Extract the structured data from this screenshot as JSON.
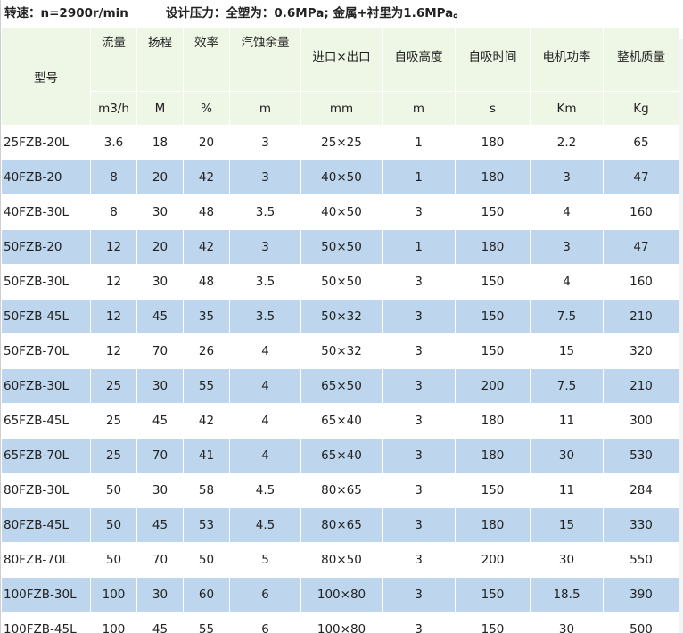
{
  "header": {
    "speed": "转速：n=2900r/min",
    "pressure": "设计压力：全塑为：0.6MPa; 金属+衬里为1.6MPa。"
  },
  "table": {
    "model_header": "型号",
    "columns": [
      {
        "name": "流量",
        "unit": "m3/h"
      },
      {
        "name": "扬程",
        "unit": "M"
      },
      {
        "name": "效率",
        "unit": "%"
      },
      {
        "name": "汽蚀余量",
        "unit": "m"
      },
      {
        "name": "进口×出口",
        "unit": "mm"
      },
      {
        "name": "自吸高度",
        "unit": "m"
      },
      {
        "name": "自吸时间",
        "unit": "s"
      },
      {
        "name": "电机功率",
        "unit": "Km"
      },
      {
        "name": "整机质量",
        "unit": "Kg"
      }
    ],
    "rows": [
      [
        "25FZB-20L",
        "3.6",
        "18",
        "20",
        "3",
        "25×25",
        "1",
        "180",
        "2.2",
        "65"
      ],
      [
        "40FZB-20",
        "8",
        "20",
        "42",
        "3",
        "40×50",
        "1",
        "180",
        "3",
        "47"
      ],
      [
        "40FZB-30L",
        "8",
        "30",
        "48",
        "3.5",
        "40×50",
        "3",
        "150",
        "4",
        "160"
      ],
      [
        "50FZB-20",
        "12",
        "20",
        "42",
        "3",
        "50×50",
        "1",
        "180",
        "3",
        "47"
      ],
      [
        "50FZB-30L",
        "12",
        "30",
        "48",
        "3.5",
        "50×50",
        "3",
        "150",
        "4",
        "160"
      ],
      [
        "50FZB-45L",
        "12",
        "45",
        "35",
        "3.5",
        "50×32",
        "3",
        "150",
        "7.5",
        "210"
      ],
      [
        "50FZB-70L",
        "12",
        "70",
        "26",
        "4",
        "50×32",
        "3",
        "150",
        "15",
        "320"
      ],
      [
        "60FZB-30L",
        "25",
        "30",
        "55",
        "4",
        "65×50",
        "3",
        "200",
        "7.5",
        "210"
      ],
      [
        "65FZB-45L",
        "25",
        "45",
        "42",
        "4",
        "65×40",
        "3",
        "180",
        "11",
        "300"
      ],
      [
        "65FZB-70L",
        "25",
        "70",
        "41",
        "4",
        "65×40",
        "3",
        "180",
        "30",
        "530"
      ],
      [
        "80FZB-30L",
        "50",
        "30",
        "58",
        "4.5",
        "80×65",
        "3",
        "150",
        "11",
        "284"
      ],
      [
        "80FZB-45L",
        "50",
        "45",
        "53",
        "4.5",
        "80×65",
        "3",
        "180",
        "15",
        "330"
      ],
      [
        "80FZB-70L",
        "50",
        "70",
        "50",
        "5",
        "80×50",
        "3",
        "200",
        "30",
        "550"
      ],
      [
        "100FZB-30L",
        "100",
        "30",
        "60",
        "6",
        "100×80",
        "3",
        "150",
        "18.5",
        "390"
      ],
      [
        "100FZB-45L",
        "100",
        "45",
        "55",
        "6",
        "100×80",
        "3",
        "150",
        "30",
        "500"
      ]
    ]
  },
  "colors": {
    "header_bg": "#eef6e6",
    "highlight_row": "#bdd6ee",
    "plain_row": "#ffffff"
  }
}
